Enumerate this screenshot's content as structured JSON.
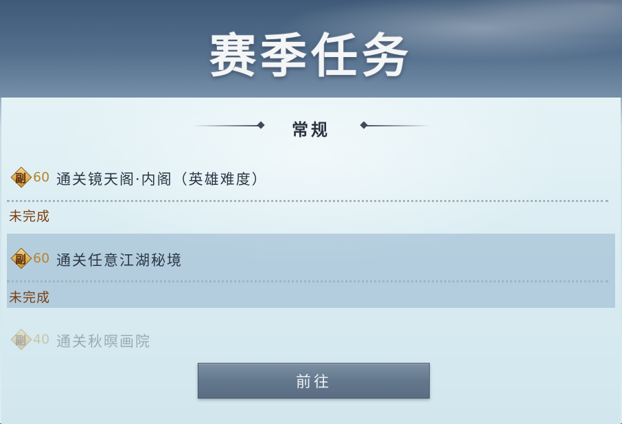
{
  "header": {
    "title": "赛季任务"
  },
  "section": {
    "title": "常规"
  },
  "tasks": [
    {
      "badge": "副",
      "points": "60",
      "name": "通关镜天阁·内阁（英雄难度）",
      "status": "未完成"
    },
    {
      "badge": "副",
      "points": "60",
      "name": "通关任意江湖秘境",
      "status": "未完成"
    },
    {
      "badge": "副",
      "points": "40",
      "name": "通关秋暝画院"
    }
  ],
  "actions": {
    "go_label": "前往"
  },
  "colors": {
    "accent_gold": "#c98f2f",
    "status_text": "#7a3e0e",
    "button": "#64788d"
  },
  "icons": {
    "badge_icon": "diamond-badge-icon",
    "header_ornament": "diamond-line-ornament-icon"
  }
}
